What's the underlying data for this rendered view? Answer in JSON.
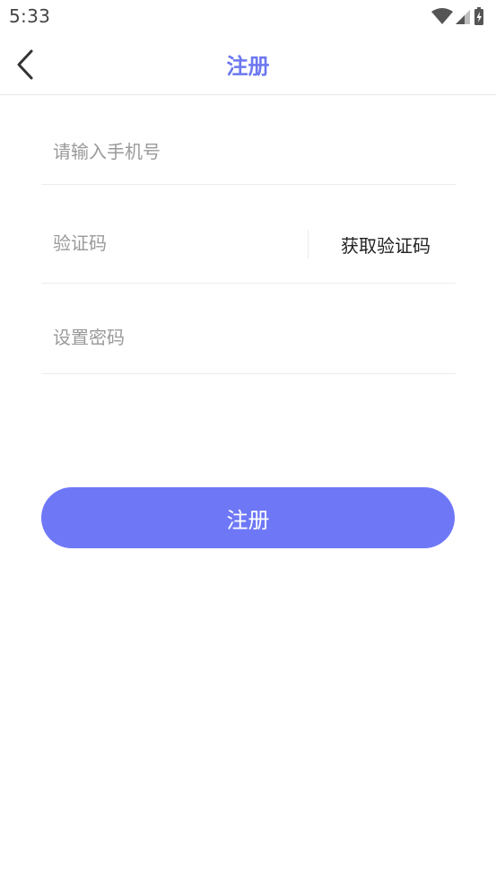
{
  "status_bar": {
    "time": "5:33",
    "icons": [
      "wifi-icon",
      "cell-signal-icon",
      "battery-charging-icon"
    ]
  },
  "navbar": {
    "back_icon": "chevron-left-icon",
    "title": "注册",
    "title_color": "#6c78f0"
  },
  "form": {
    "phone_placeholder": "请输入手机号",
    "phone_value": "",
    "code_placeholder": "验证码",
    "code_value": "",
    "get_code_label": "获取验证码",
    "password_placeholder": "设置密码",
    "password_value": ""
  },
  "submit": {
    "label": "注册",
    "color": "#6e78f6"
  }
}
